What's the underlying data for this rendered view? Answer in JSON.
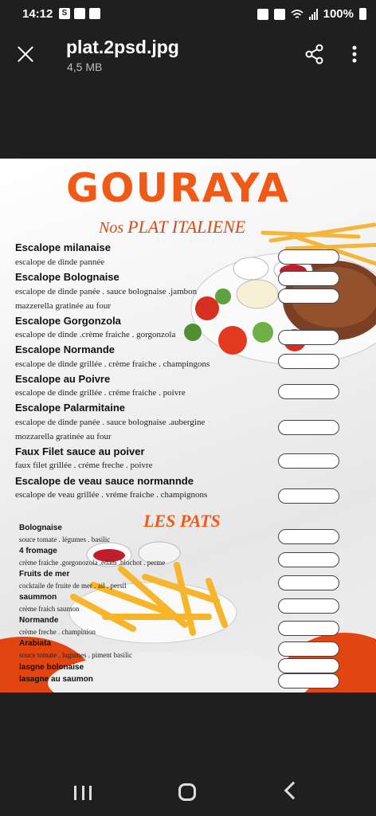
{
  "status": {
    "time": "14:12",
    "battery": "100%"
  },
  "viewer": {
    "file_name": "plat.2psd.jpg",
    "file_size": "4,5 MB"
  },
  "menu": {
    "brand": "GOURAYA",
    "subtitle_prefix": "Nos",
    "subtitle": "PLAT ITALIENE",
    "italian_items": [
      {
        "name": "Escalope milanaise",
        "desc": "escalope de dinde pannée"
      },
      {
        "name": "Escalope Bolognaise",
        "desc": "escalope de dinde panée . sauce bolognaise .jambon",
        "desc2": "mazzerella gratinée au four"
      },
      {
        "name": "Escalope Gorgonzola",
        "desc": "escalope de dinde .crème fraiche . gorgonzola"
      },
      {
        "name": "Escalope Normande",
        "desc": "escalope de dinde grillée . crème fraiche . champingons"
      },
      {
        "name": "Escalope au Poivre",
        "desc": "escalope de dinde grillée . créme fraiche . poivre"
      },
      {
        "name": "Escalope Palarmitaine",
        "desc": "escalope de dinde panée . sauce bolognaise .aubergine",
        "desc2": "mozzarella gratinée au four"
      },
      {
        "name": "Faux Filet sauce au poiver",
        "desc": "faux filet grillée . créme freche . poivre"
      },
      {
        "name": "Escalope de veau sauce normannde",
        "desc": "escalope de veau grillée . vréme fraiche . champignons"
      }
    ],
    "pasta_heading": "LES PATS",
    "pasta_items": [
      {
        "name": "Bolognaise",
        "desc": "souce tomate . légumes . basilic"
      },
      {
        "name": "4 fromage",
        "desc": "crème fraiche .gorgonozola .edam .blochot . perme"
      },
      {
        "name": "Fruits de mer",
        "desc": "cocktaile de fruite de mer . ail . persil"
      },
      {
        "name": "saummon",
        "desc": "crème fraich saumon"
      },
      {
        "name": "Normande",
        "desc": "crème freche . champinion"
      },
      {
        "name": "Arabiata",
        "desc": "souce tomate . lugumes . piment basilic"
      },
      {
        "name": "lasgne bolonaise",
        "desc": ""
      },
      {
        "name": "lasagne au saumon",
        "desc": ""
      }
    ]
  }
}
